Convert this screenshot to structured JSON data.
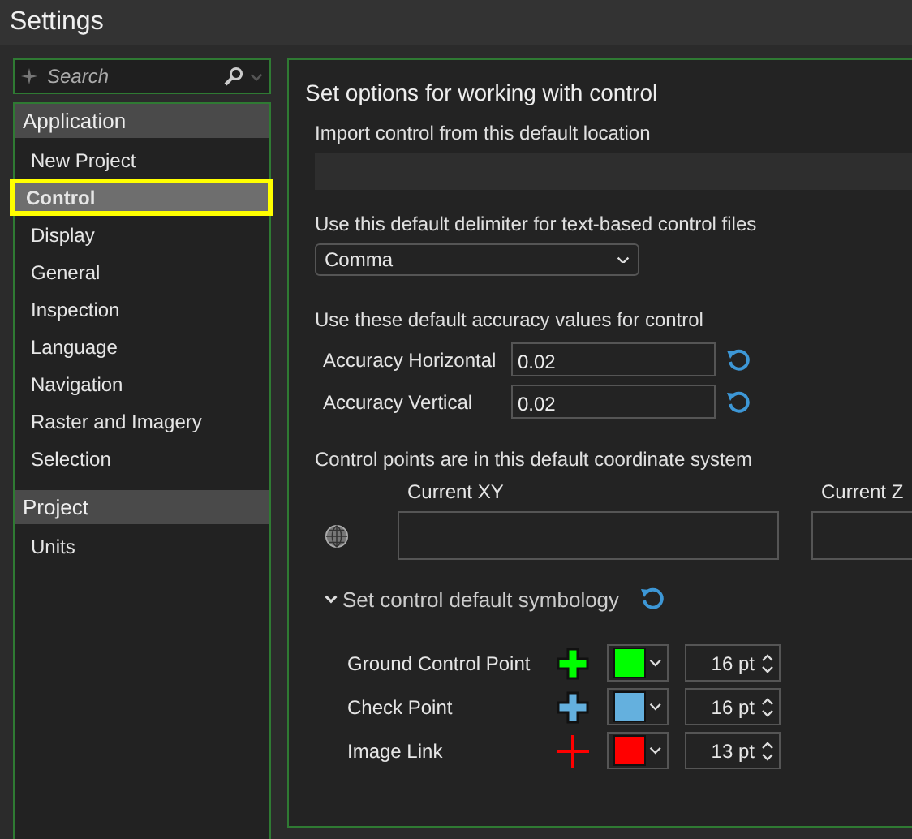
{
  "window": {
    "title": "Settings"
  },
  "search": {
    "placeholder": "Search"
  },
  "sidebar": {
    "groups": [
      {
        "label": "Application",
        "items": [
          {
            "label": "New Project",
            "selected": false,
            "highlighted": false
          },
          {
            "label": "Control",
            "selected": true,
            "highlighted": true
          },
          {
            "label": "Display",
            "selected": false,
            "highlighted": false
          },
          {
            "label": "General",
            "selected": false,
            "highlighted": false
          },
          {
            "label": "Inspection",
            "selected": false,
            "highlighted": false
          },
          {
            "label": "Language",
            "selected": false,
            "highlighted": false
          },
          {
            "label": "Navigation",
            "selected": false,
            "highlighted": false
          },
          {
            "label": "Raster and Imagery",
            "selected": false,
            "highlighted": false
          },
          {
            "label": "Selection",
            "selected": false,
            "highlighted": false
          }
        ]
      },
      {
        "label": "Project",
        "items": [
          {
            "label": "Units",
            "selected": false,
            "highlighted": false
          }
        ]
      }
    ]
  },
  "panel": {
    "heading": "Set options for working with control",
    "import": {
      "label": "Import control from this default location"
    },
    "delimiter": {
      "label": "Use this default delimiter for text-based control files",
      "value": "Comma"
    },
    "accuracy": {
      "label": "Use these default accuracy values for control",
      "rows": [
        {
          "label": "Accuracy Horizontal",
          "value": "0.02"
        },
        {
          "label": "Accuracy Vertical",
          "value": "0.02"
        }
      ]
    },
    "coordinates": {
      "label": "Control points are in this default coordinate system",
      "xy_label": "Current XY",
      "z_label": "Current Z"
    },
    "symbology": {
      "label": "Set control default symbology",
      "expanded": true,
      "rows": [
        {
          "label": "Ground Control Point",
          "kind": "thick-cross",
          "color": "#00ff00",
          "size": "16 pt"
        },
        {
          "label": "Check Point",
          "kind": "thick-cross",
          "color": "#64b0de",
          "size": "16 pt"
        },
        {
          "label": "Image Link",
          "kind": "thin-cross",
          "color": "#ff0000",
          "size": "13 pt"
        }
      ]
    }
  }
}
